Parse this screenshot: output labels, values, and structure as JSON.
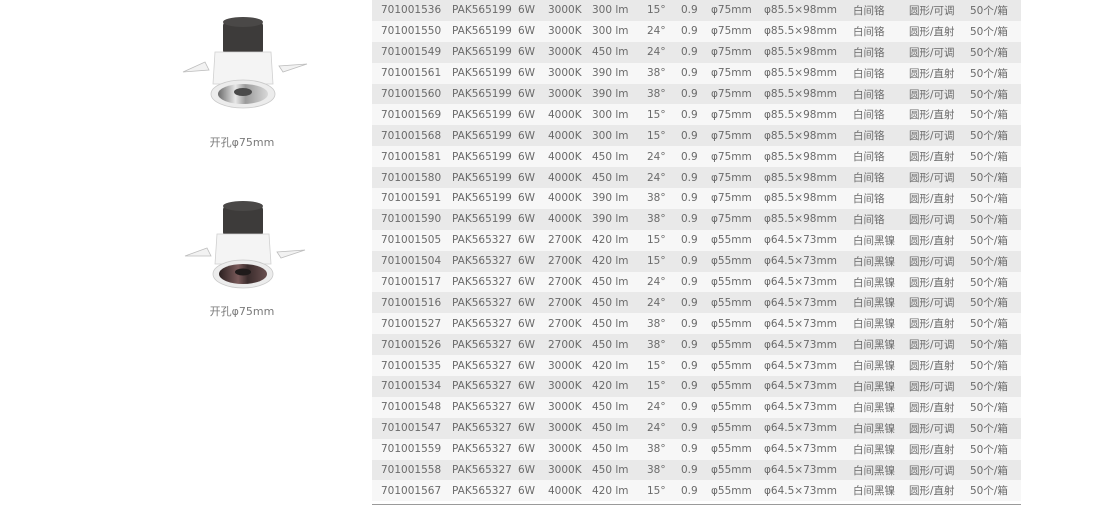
{
  "products": [
    {
      "cutout_label": "开孔φ75mm",
      "image": "silver-reflector-downlight"
    },
    {
      "cutout_label": "开孔φ75mm",
      "image": "black-nickel-reflector-downlight"
    }
  ],
  "colors": {
    "row_shade": "#e9e9e9",
    "row_plain": "#f7f7f7",
    "text": "#6a6a6a"
  },
  "rows": [
    [
      "701001536",
      "PAK565199",
      "6W",
      "3000K",
      "300 lm",
      "15°",
      "0.9",
      "φ75mm",
      "φ85.5×98mm",
      "白间铬",
      "圆形/可调",
      "50个/箱"
    ],
    [
      "701001550",
      "PAK565199",
      "6W",
      "3000K",
      "300 lm",
      "24°",
      "0.9",
      "φ75mm",
      "φ85.5×98mm",
      "白间铬",
      "圆形/直射",
      "50个/箱"
    ],
    [
      "701001549",
      "PAK565199",
      "6W",
      "3000K",
      "450 lm",
      "24°",
      "0.9",
      "φ75mm",
      "φ85.5×98mm",
      "白间铬",
      "圆形/可调",
      "50个/箱"
    ],
    [
      "701001561",
      "PAK565199",
      "6W",
      "3000K",
      "390 lm",
      "38°",
      "0.9",
      "φ75mm",
      "φ85.5×98mm",
      "白间铬",
      "圆形/直射",
      "50个/箱"
    ],
    [
      "701001560",
      "PAK565199",
      "6W",
      "3000K",
      "390 lm",
      "38°",
      "0.9",
      "φ75mm",
      "φ85.5×98mm",
      "白间铬",
      "圆形/可调",
      "50个/箱"
    ],
    [
      "701001569",
      "PAK565199",
      "6W",
      "4000K",
      "300 lm",
      "15°",
      "0.9",
      "φ75mm",
      "φ85.5×98mm",
      "白间铬",
      "圆形/直射",
      "50个/箱"
    ],
    [
      "701001568",
      "PAK565199",
      "6W",
      "4000K",
      "300 lm",
      "15°",
      "0.9",
      "φ75mm",
      "φ85.5×98mm",
      "白间铬",
      "圆形/可调",
      "50个/箱"
    ],
    [
      "701001581",
      "PAK565199",
      "6W",
      "4000K",
      "450 lm",
      "24°",
      "0.9",
      "φ75mm",
      "φ85.5×98mm",
      "白间铬",
      "圆形/直射",
      "50个/箱"
    ],
    [
      "701001580",
      "PAK565199",
      "6W",
      "4000K",
      "450 lm",
      "24°",
      "0.9",
      "φ75mm",
      "φ85.5×98mm",
      "白间铬",
      "圆形/可调",
      "50个/箱"
    ],
    [
      "701001591",
      "PAK565199",
      "6W",
      "4000K",
      "390 lm",
      "38°",
      "0.9",
      "φ75mm",
      "φ85.5×98mm",
      "白间铬",
      "圆形/直射",
      "50个/箱"
    ],
    [
      "701001590",
      "PAK565199",
      "6W",
      "4000K",
      "390 lm",
      "38°",
      "0.9",
      "φ75mm",
      "φ85.5×98mm",
      "白间铬",
      "圆形/可调",
      "50个/箱"
    ],
    [
      "701001505",
      "PAK565327",
      "6W",
      "2700K",
      "420 lm",
      "15°",
      "0.9",
      "φ55mm",
      "φ64.5×73mm",
      "白间黑镍",
      "圆形/直射",
      "50个/箱"
    ],
    [
      "701001504",
      "PAK565327",
      "6W",
      "2700K",
      "420 lm",
      "15°",
      "0.9",
      "φ55mm",
      "φ64.5×73mm",
      "白间黑镍",
      "圆形/可调",
      "50个/箱"
    ],
    [
      "701001517",
      "PAK565327",
      "6W",
      "2700K",
      "450 lm",
      "24°",
      "0.9",
      "φ55mm",
      "φ64.5×73mm",
      "白间黑镍",
      "圆形/直射",
      "50个/箱"
    ],
    [
      "701001516",
      "PAK565327",
      "6W",
      "2700K",
      "450 lm",
      "24°",
      "0.9",
      "φ55mm",
      "φ64.5×73mm",
      "白间黑镍",
      "圆形/可调",
      "50个/箱"
    ],
    [
      "701001527",
      "PAK565327",
      "6W",
      "2700K",
      "450 lm",
      "38°",
      "0.9",
      "φ55mm",
      "φ64.5×73mm",
      "白间黑镍",
      "圆形/直射",
      "50个/箱"
    ],
    [
      "701001526",
      "PAK565327",
      "6W",
      "2700K",
      "450 lm",
      "38°",
      "0.9",
      "φ55mm",
      "φ64.5×73mm",
      "白间黑镍",
      "圆形/可调",
      "50个/箱"
    ],
    [
      "701001535",
      "PAK565327",
      "6W",
      "3000K",
      "420 lm",
      "15°",
      "0.9",
      "φ55mm",
      "φ64.5×73mm",
      "白间黑镍",
      "圆形/直射",
      "50个/箱"
    ],
    [
      "701001534",
      "PAK565327",
      "6W",
      "3000K",
      "420 lm",
      "15°",
      "0.9",
      "φ55mm",
      "φ64.5×73mm",
      "白间黑镍",
      "圆形/可调",
      "50个/箱"
    ],
    [
      "701001548",
      "PAK565327",
      "6W",
      "3000K",
      "450 lm",
      "24°",
      "0.9",
      "φ55mm",
      "φ64.5×73mm",
      "白间黑镍",
      "圆形/直射",
      "50个/箱"
    ],
    [
      "701001547",
      "PAK565327",
      "6W",
      "3000K",
      "450 lm",
      "24°",
      "0.9",
      "φ55mm",
      "φ64.5×73mm",
      "白间黑镍",
      "圆形/可调",
      "50个/箱"
    ],
    [
      "701001559",
      "PAK565327",
      "6W",
      "3000K",
      "450 lm",
      "38°",
      "0.9",
      "φ55mm",
      "φ64.5×73mm",
      "白间黑镍",
      "圆形/直射",
      "50个/箱"
    ],
    [
      "701001558",
      "PAK565327",
      "6W",
      "3000K",
      "450 lm",
      "38°",
      "0.9",
      "φ55mm",
      "φ64.5×73mm",
      "白间黑镍",
      "圆形/可调",
      "50个/箱"
    ],
    [
      "701001567",
      "PAK565327",
      "6W",
      "4000K",
      "420 lm",
      "15°",
      "0.9",
      "φ55mm",
      "φ64.5×73mm",
      "白间黑镍",
      "圆形/直射",
      "50个/箱"
    ]
  ]
}
